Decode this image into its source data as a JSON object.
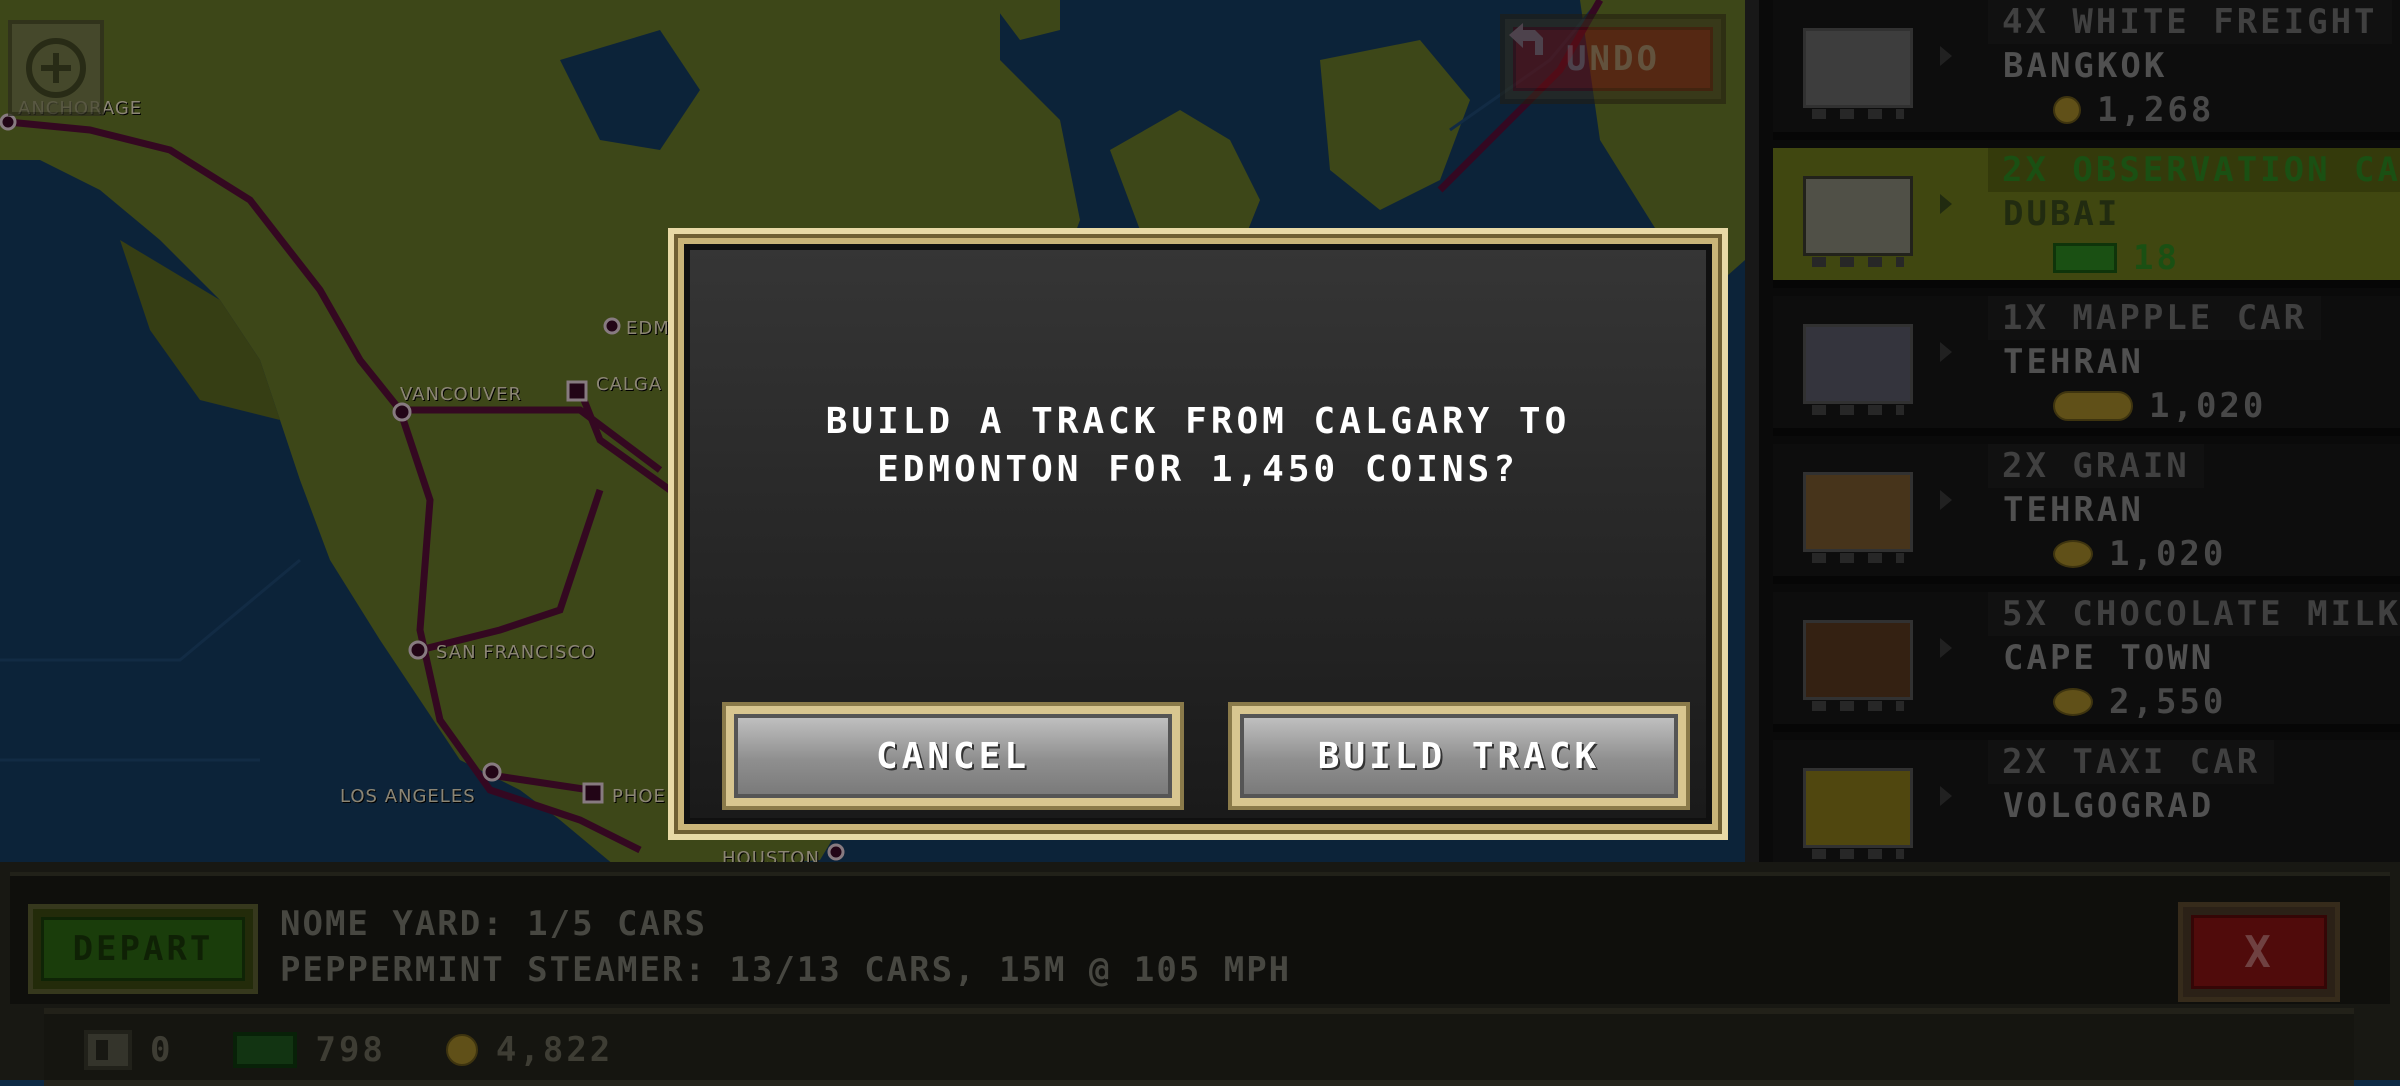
{
  "map": {
    "cities": {
      "anchorage": "ANCHORAGE",
      "vancouver": "VANCOUVER",
      "edmonton": "EDM",
      "calgary": "CALGA",
      "san_francisco": "SAN FRANCISCO",
      "los_angeles": "LOS ANGELES",
      "phoenix": "PHOE",
      "houston": "HOUSTON"
    }
  },
  "toolbar": {
    "undo_label": "UNDO",
    "zoom_icon": "plus-icon"
  },
  "shop": {
    "items": [
      {
        "tag": "4X WHITE FREIGHT",
        "destination": "BANGKOK",
        "price": "1,268",
        "selected": false
      },
      {
        "tag": "2X OBSERVATION CA",
        "destination": "DUBAI",
        "price": "18",
        "selected": true
      },
      {
        "tag": "1X MAPPLE CAR",
        "destination": "TEHRAN",
        "price": "1,020",
        "selected": false
      },
      {
        "tag": "2X GRAIN",
        "destination": "TEHRAN",
        "price": "1,020",
        "selected": false
      },
      {
        "tag": "5X CHOCOLATE MILK",
        "destination": "CAPE TOWN",
        "price": "2,550",
        "selected": false
      },
      {
        "tag": "2X TAXI CAR",
        "destination": "VOLGOGRAD",
        "price": "",
        "selected": false
      }
    ]
  },
  "bottom": {
    "depart_label": "DEPART",
    "yard_status": "NOME YARD: 1/5 CARS",
    "train_status": "PEPPERMINT STEAMER: 13/13 CARS, 15M @ 105 MPH",
    "close_label": "X"
  },
  "resources": {
    "cars": "0",
    "cash": "798",
    "coins": "4,822"
  },
  "dialog": {
    "line1": "BUILD A TRACK FROM CALGARY TO",
    "line2": "EDMONTON FOR 1,450 COINS?",
    "cancel_label": "CANCEL",
    "build_label": "BUILD TRACK"
  },
  "colors": {
    "land": "#6a7a2a",
    "water": "#163d63",
    "track": "#5a0f3a",
    "accent_gold": "#c9b478"
  }
}
